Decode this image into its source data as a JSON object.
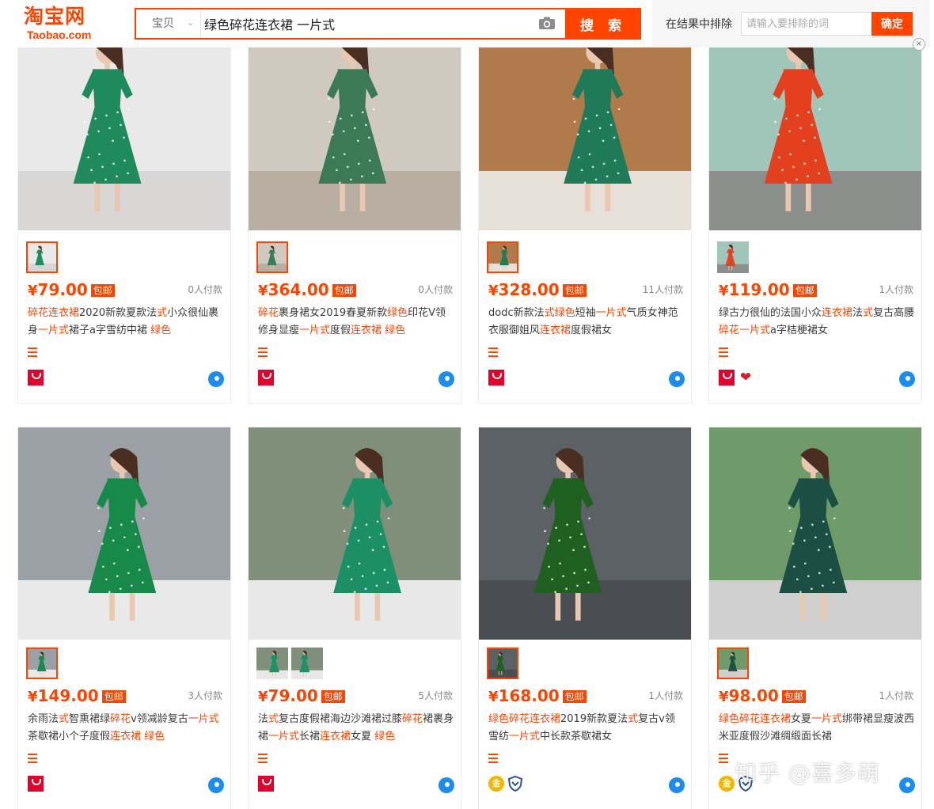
{
  "header": {
    "logo_cn": "淘宝网",
    "logo_en": "Taobao.com",
    "category": "宝贝",
    "query": "绿色碎花连衣裙 一片式",
    "search_label": "搜 索",
    "exclude_label": "在结果中排除",
    "exclude_placeholder": "请输入要排除的词",
    "exclude_button": "确定",
    "close_glyph": "×"
  },
  "products": [
    {
      "price": "79.00",
      "baoyou": "包邮",
      "paid": "0人付款",
      "title": [
        {
          "t": "碎花连衣裙",
          "hl": true
        },
        {
          "t": "2020新款夏款法",
          "hl": false
        },
        {
          "t": "式",
          "hl": true
        },
        {
          "t": "小众很仙裹身",
          "hl": false
        },
        {
          "t": "一片式",
          "hl": true
        },
        {
          "t": "裙子a字雪纺中裙 ",
          "hl": false
        },
        {
          "t": "绿色",
          "hl": true
        }
      ],
      "shop_badge": "tmall",
      "extra_badge": "",
      "dress": "#1f8a5b",
      "bg": "#e9e9ea",
      "floor": "#d8d7d5",
      "thumbs": [
        1
      ]
    },
    {
      "price": "364.00",
      "baoyou": "包邮",
      "paid": "0人付款",
      "title": [
        {
          "t": "碎花",
          "hl": true
        },
        {
          "t": "裹身裙女2019春夏新款",
          "hl": false
        },
        {
          "t": "绿色",
          "hl": true
        },
        {
          "t": "印花V领修身显瘦",
          "hl": false
        },
        {
          "t": "一片式",
          "hl": true
        },
        {
          "t": "度假",
          "hl": false
        },
        {
          "t": "连衣裙",
          "hl": true
        },
        {
          "t": " ",
          "hl": false
        },
        {
          "t": "绿色",
          "hl": true
        }
      ],
      "shop_badge": "tmall",
      "extra_badge": "",
      "dress": "#3c7a55",
      "bg": "#cfc9c0",
      "floor": "#b8aea2",
      "thumbs": [
        1
      ]
    },
    {
      "price": "328.00",
      "baoyou": "包邮",
      "paid": "11人付款",
      "title": [
        {
          "t": "dodc新款法",
          "hl": false
        },
        {
          "t": "式绿色",
          "hl": true
        },
        {
          "t": "短袖",
          "hl": false
        },
        {
          "t": "一片式",
          "hl": true
        },
        {
          "t": "气质女神范衣服御姐风",
          "hl": false
        },
        {
          "t": "连衣裙",
          "hl": true
        },
        {
          "t": "度假裙女",
          "hl": false
        }
      ],
      "shop_badge": "tmall",
      "extra_badge": "",
      "dress": "#1e7a58",
      "bg": "#b07a4a",
      "floor": "#e6e0d8",
      "thumbs": [
        1
      ]
    },
    {
      "price": "119.00",
      "baoyou": "包邮",
      "paid": "1人付款",
      "title": [
        {
          "t": "绿古力很仙的法国小众",
          "hl": false
        },
        {
          "t": "连衣裙",
          "hl": true
        },
        {
          "t": "法",
          "hl": false
        },
        {
          "t": "式",
          "hl": true
        },
        {
          "t": "复古高腰",
          "hl": false
        },
        {
          "t": "碎花一片式",
          "hl": true
        },
        {
          "t": "a字桔梗裙女",
          "hl": false
        }
      ],
      "shop_badge": "tmall",
      "extra_badge": "heart",
      "dress": "#e2401f",
      "bg": "#9fc6b8",
      "floor": "#8a8f8c",
      "thumbs": [
        0
      ]
    },
    {
      "price": "149.00",
      "baoyou": "包邮",
      "paid": "3人付款",
      "title": [
        {
          "t": "余雨法",
          "hl": false
        },
        {
          "t": "式",
          "hl": true
        },
        {
          "t": "智熏裙绿",
          "hl": false
        },
        {
          "t": "碎花",
          "hl": true
        },
        {
          "t": "v领减龄复古",
          "hl": false
        },
        {
          "t": "一片式",
          "hl": true
        },
        {
          "t": "茶歇裙小个子度假",
          "hl": false
        },
        {
          "t": "连衣裙 绿色",
          "hl": true
        }
      ],
      "shop_badge": "tmall",
      "extra_badge": "",
      "dress": "#178a4a",
      "bg": "#9aa0a6",
      "floor": "#e9e9e9",
      "thumbs": [
        1
      ]
    },
    {
      "price": "79.00",
      "baoyou": "包邮",
      "paid": "5人付款",
      "title": [
        {
          "t": "法",
          "hl": false
        },
        {
          "t": "式",
          "hl": true
        },
        {
          "t": "复古度假裙海边沙滩裙过膝",
          "hl": false
        },
        {
          "t": "碎花",
          "hl": true
        },
        {
          "t": "裙裹身裙",
          "hl": false
        },
        {
          "t": "一片式",
          "hl": true
        },
        {
          "t": "长裙",
          "hl": false
        },
        {
          "t": "连衣裙",
          "hl": true
        },
        {
          "t": "女夏 ",
          "hl": false
        },
        {
          "t": "绿色",
          "hl": true
        }
      ],
      "shop_badge": "tmall",
      "extra_badge": "",
      "dress": "#1d8f66",
      "bg": "#7f8f7a",
      "floor": "#e8e8e8",
      "thumbs": [
        0,
        0
      ]
    },
    {
      "price": "168.00",
      "baoyou": "包邮",
      "paid": "1人付款",
      "title": [
        {
          "t": "绿色碎花连衣裙",
          "hl": true
        },
        {
          "t": "2019新款夏法",
          "hl": false
        },
        {
          "t": "式",
          "hl": true
        },
        {
          "t": "复古v领雪纺",
          "hl": false
        },
        {
          "t": "一片式",
          "hl": true
        },
        {
          "t": "中长款茶歇裙女",
          "hl": false
        }
      ],
      "shop_badge": "gold",
      "extra_badge": "shield",
      "dress": "#1f5f1f",
      "bg": "#5c6166",
      "floor": "#4a4e53",
      "thumbs": [
        1
      ]
    },
    {
      "price": "98.00",
      "baoyou": "包邮",
      "paid": "1人付款",
      "title": [
        {
          "t": "绿色碎花连衣裙",
          "hl": true
        },
        {
          "t": "女夏",
          "hl": false
        },
        {
          "t": "一片式",
          "hl": true
        },
        {
          "t": "绑带裙显瘦波西米亚度假沙滩绸缎面长裙",
          "hl": false
        }
      ],
      "shop_badge": "gold",
      "extra_badge": "shield",
      "dress": "#1c4f43",
      "bg": "#6f9a6a",
      "floor": "#cfcfcf",
      "thumbs": [
        1
      ]
    }
  ],
  "icons": {
    "logo": "taobao-logo",
    "category_chevron": "chevron-down-icon",
    "camera": "camera-icon",
    "menu": "menu-icon",
    "tmall": "tmall-icon",
    "wangwang": "wangwang-chat-icon",
    "gold": "gold-seller-icon",
    "shield": "shield-icon",
    "heart": "heart-icon"
  },
  "colors": {
    "brand": "#ff4400",
    "text": "#3c3c3c",
    "muted": "#888888",
    "tmall": "#e4002b",
    "wangwang": "#1b8cf0"
  },
  "watermark": "知乎 @喜多萌"
}
